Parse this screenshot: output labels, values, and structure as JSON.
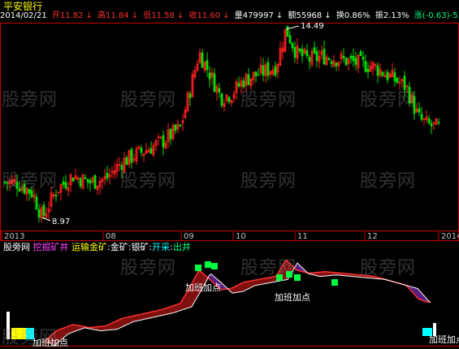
{
  "stock_name": "平安银行",
  "info": {
    "date": "2014/02/21",
    "open": "开11.82",
    "high": "高11.84",
    "low": "低11.58",
    "close": "收11.60",
    "vol": "量479997",
    "amount": "额55968",
    "turnover": "换0.86%",
    "amplitude": "振2.13%",
    "change": "涨(-0.63)-5."
  },
  "colors": {
    "up": "#ff2020",
    "down": "#00e000",
    "axis": "#c00000",
    "background": "#000000"
  },
  "annotations": {
    "high": "14.49",
    "low": "8.97"
  },
  "x_axis": [
    "2013",
    "08",
    "09",
    "10",
    "11",
    "12",
    "2014"
  ],
  "indicator": {
    "name": "股旁网",
    "formula_name": "挖掘矿井",
    "lines": [
      "运输金矿",
      "金矿",
      "银矿",
      "开采",
      "出井"
    ],
    "signal_labels": [
      "加班加点",
      "加班加点",
      "加班加点",
      "加班加点"
    ]
  },
  "watermark": "股旁网",
  "chart_data": {
    "type": "candlestick",
    "x_ticks": [
      "2013",
      "08",
      "09",
      "10",
      "11",
      "12",
      "2014"
    ],
    "low_mark": 8.97,
    "high_mark": 14.49,
    "last_close": 11.6
  }
}
